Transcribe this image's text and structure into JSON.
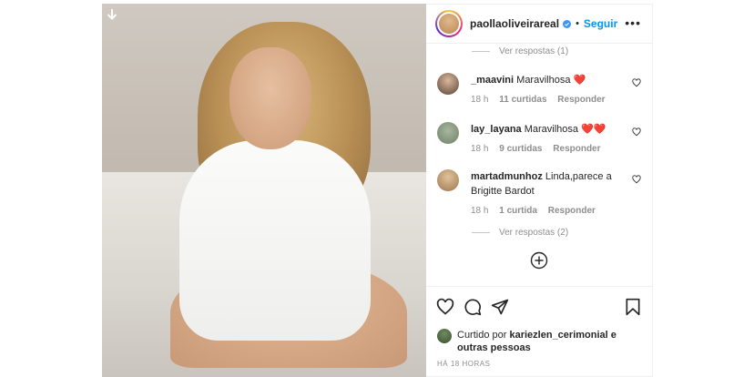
{
  "header": {
    "username": "paollaoliveirareal",
    "separator": "•",
    "follow_label": "Seguir",
    "more_label": "•••"
  },
  "comments": {
    "top_replies": "Ver respostas (1)",
    "items": [
      {
        "user": "_maavini",
        "text": "Maravilhosa",
        "emoji": "❤️",
        "time": "18 h",
        "likes": "11 curtidas",
        "reply": "Responder"
      },
      {
        "user": "lay_layana",
        "text": "Maravilhosa",
        "emoji": "❤️❤️",
        "time": "18 h",
        "likes": "9 curtidas",
        "reply": "Responder"
      },
      {
        "user": "martadmunhoz",
        "text": "Linda,parece a Brigitte Bardot",
        "emoji": "",
        "time": "18 h",
        "likes": "1 curtida",
        "reply": "Responder"
      }
    ],
    "bottom_replies": "Ver respostas (2)"
  },
  "likes": {
    "prefix": "Curtido por",
    "user": "kariezlen_cerimonial",
    "suffix": "e outras pessoas"
  },
  "timestamp": "HÁ 18 HORAS",
  "colors": {
    "accent": "#0095f6",
    "text": "#262626",
    "muted": "#8e8e8e",
    "border": "#efefef"
  },
  "icons": [
    "download-icon",
    "verified-icon",
    "heart-icon",
    "comment-icon",
    "share-icon",
    "bookmark-icon",
    "add-circle-icon"
  ]
}
